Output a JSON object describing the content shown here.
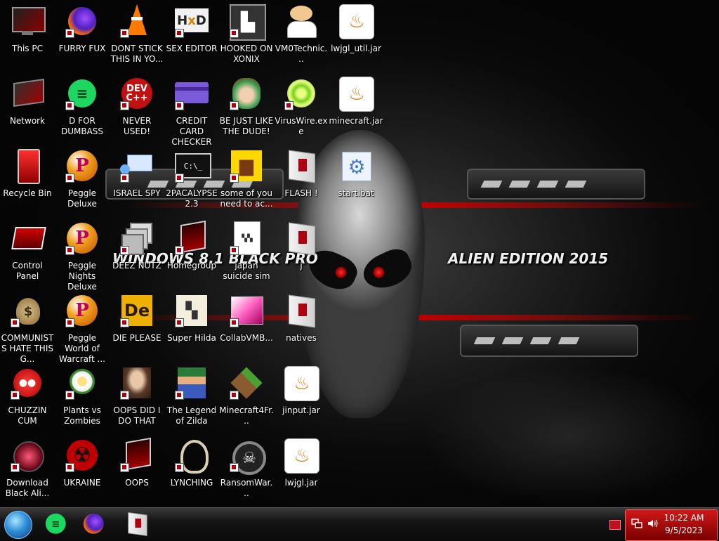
{
  "desktop": {
    "icons": [
      {
        "id": "this-pc",
        "label": "This PC",
        "col": 0,
        "row": 0,
        "icon": "monitor-icon"
      },
      {
        "id": "network",
        "label": "Network",
        "col": 0,
        "row": 1,
        "icon": "network-icon"
      },
      {
        "id": "recycle-bin",
        "label": "Recycle Bin",
        "col": 0,
        "row": 2,
        "icon": "recycle-bin-icon"
      },
      {
        "id": "control-panel",
        "label": "Control Panel",
        "col": 0,
        "row": 3,
        "icon": "control-panel-icon"
      },
      {
        "id": "communists",
        "label": "COMMUNISTS HATE THIS G...",
        "col": 0,
        "row": 4,
        "icon": "money-bag-icon"
      },
      {
        "id": "chuzzin",
        "label": "CHUZZIN CUM",
        "col": 0,
        "row": 5,
        "icon": "red-creature-icon"
      },
      {
        "id": "download-alien",
        "label": "Download Black Ali...",
        "col": 0,
        "row": 6,
        "icon": "alien-orb-icon"
      },
      {
        "id": "furry-fux",
        "label": "FURRY FUX",
        "col": 1,
        "row": 0,
        "icon": "firefox-icon"
      },
      {
        "id": "d-for",
        "label": "D FOR DUMBASS",
        "col": 1,
        "row": 1,
        "icon": "green-chat-icon"
      },
      {
        "id": "peggle-deluxe",
        "label": "Peggle Deluxe",
        "col": 1,
        "row": 2,
        "icon": "peggle-icon"
      },
      {
        "id": "peggle-nights",
        "label": "Peggle Nights Deluxe",
        "col": 1,
        "row": 3,
        "icon": "peggle-icon"
      },
      {
        "id": "peggle-world",
        "label": "Peggle World of Warcraft ...",
        "col": 1,
        "row": 4,
        "icon": "peggle-icon"
      },
      {
        "id": "plants-vs-zombies",
        "label": "Plants vs Zombies",
        "col": 1,
        "row": 5,
        "icon": "flower-icon"
      },
      {
        "id": "ukraine",
        "label": "UKRAINE",
        "col": 1,
        "row": 6,
        "icon": "radiation-icon"
      },
      {
        "id": "dont-stick",
        "label": "DONT STICK THIS IN YO...",
        "col": 2,
        "row": 0,
        "icon": "traffic-cone-icon"
      },
      {
        "id": "never-used",
        "label": "NEVER USED!",
        "col": 2,
        "row": 1,
        "icon": "dev-cpp-icon"
      },
      {
        "id": "israel-spy",
        "label": "ISRAEL SPY",
        "col": 2,
        "row": 2,
        "icon": "network-spy-icon"
      },
      {
        "id": "deez-nutz",
        "label": "DEEZ NUTZ",
        "col": 2,
        "row": 3,
        "icon": "stacked-windows-icon"
      },
      {
        "id": "die-please",
        "label": "DIE PLEASE",
        "col": 2,
        "row": 4,
        "icon": "de-icon"
      },
      {
        "id": "oops-did-i",
        "label": "OOPS DID I DO THAT",
        "col": 2,
        "row": 5,
        "icon": "portrait-icon"
      },
      {
        "id": "oops",
        "label": "OOPS",
        "col": 2,
        "row": 6,
        "icon": "red-monitor-icon"
      },
      {
        "id": "sex-editor",
        "label": "SEX EDITOR",
        "col": 3,
        "row": 0,
        "icon": "hxd-icon"
      },
      {
        "id": "credit-card",
        "label": "CREDIT CARD CHECKER",
        "col": 3,
        "row": 1,
        "icon": "credit-card-icon"
      },
      {
        "id": "2pacalypse",
        "label": "2PACALYPSE 2.3",
        "col": 3,
        "row": 2,
        "icon": "terminal-icon"
      },
      {
        "id": "homegroup",
        "label": "Homegroup",
        "col": 3,
        "row": 3,
        "icon": "red-monitor-icon"
      },
      {
        "id": "super-hilda",
        "label": "Super Hilda",
        "col": 3,
        "row": 4,
        "icon": "pixel-dog-icon"
      },
      {
        "id": "legend-zilda",
        "label": "The Legend of Zilda",
        "col": 3,
        "row": 5,
        "icon": "pixel-hero-icon"
      },
      {
        "id": "lynching",
        "label": "LYNCHING",
        "col": 3,
        "row": 6,
        "icon": "noose-icon"
      },
      {
        "id": "hooked-xonix",
        "label": "HOOKED ON XONIX",
        "col": 4,
        "row": 0,
        "icon": "maze-icon"
      },
      {
        "id": "be-just-like",
        "label": "BE JUST LIKE THE DUDE!",
        "col": 4,
        "row": 1,
        "icon": "elf-icon"
      },
      {
        "id": "some-of-you",
        "label": "some of you need to ac...",
        "col": 4,
        "row": 2,
        "icon": "beaver-icon"
      },
      {
        "id": "japan-suicide",
        "label": "japan suicide sim",
        "col": 4,
        "row": 3,
        "icon": "document-icon"
      },
      {
        "id": "collabvm",
        "label": "CollabVMB...",
        "col": 4,
        "row": 4,
        "icon": "pink-window-icon"
      },
      {
        "id": "minecraft4fr",
        "label": "Minecraft4Fr...",
        "col": 4,
        "row": 5,
        "icon": "grass-block-icon"
      },
      {
        "id": "ransomwar",
        "label": "RansomWar...",
        "col": 4,
        "row": 6,
        "icon": "skull-icon"
      },
      {
        "id": "vm0technic",
        "label": "VM0Technic...",
        "col": 5,
        "row": 0,
        "icon": "doctor-icon"
      },
      {
        "id": "viruswire",
        "label": "VirusWire.exe",
        "col": 5,
        "row": 1,
        "icon": "lime-icon"
      },
      {
        "id": "flash",
        "label": "FLASH !",
        "col": 5,
        "row": 2,
        "icon": "folder-icon"
      },
      {
        "id": "j-folder",
        "label": "j",
        "col": 5,
        "row": 3,
        "icon": "folder-icon"
      },
      {
        "id": "natives",
        "label": "natives",
        "col": 5,
        "row": 4,
        "icon": "folder-icon"
      },
      {
        "id": "jinput-jar",
        "label": "jinput.jar",
        "col": 5,
        "row": 5,
        "icon": "java-icon"
      },
      {
        "id": "lwjgl-jar",
        "label": "lwjgl.jar",
        "col": 5,
        "row": 6,
        "icon": "java-icon"
      },
      {
        "id": "lwjgl-util-jar",
        "label": "lwjgl_util.jar",
        "col": 6,
        "row": 0,
        "icon": "java-icon"
      },
      {
        "id": "minecraft-jar",
        "label": "minecraft.jar",
        "col": 6,
        "row": 1,
        "icon": "java-icon"
      },
      {
        "id": "start-bat",
        "label": "start.bat",
        "col": 6,
        "row": 2,
        "icon": "gear-icon"
      }
    ]
  },
  "wallpaper": {
    "left_text": "WINDOWS 8.1 BLACK PRO",
    "right_text": "ALIEN EDITION 2015"
  },
  "taskbar": {
    "pinned": [
      {
        "name": "green-chat-icon",
        "title": "D FOR DUMBASS"
      },
      {
        "name": "firefox-icon",
        "title": "FURRY FUX"
      },
      {
        "name": "folder-icon",
        "title": "File Explorer"
      }
    ],
    "clock": {
      "time": "10:22 AM",
      "date": "9/5/2023"
    }
  },
  "colors": {
    "accent": "#c00000",
    "tray": "#b01010",
    "taskbar": "#111111"
  }
}
